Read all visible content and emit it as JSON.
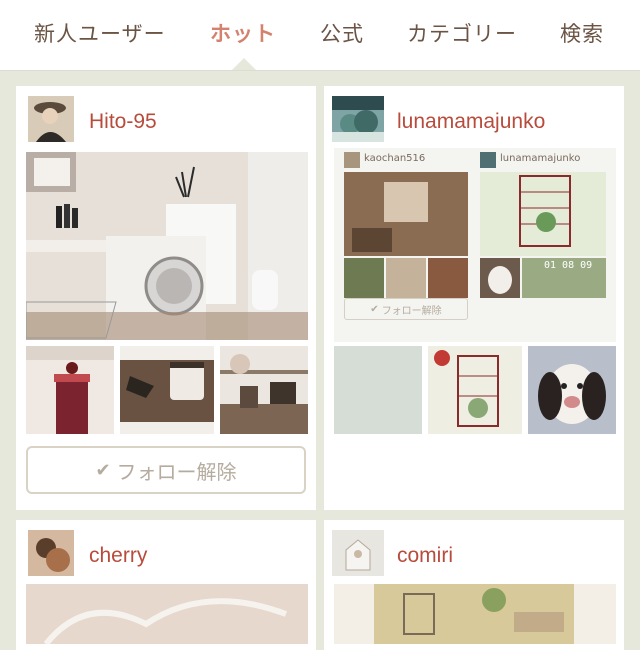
{
  "nav": {
    "items": [
      "新人ユーザー",
      "ホット",
      "公式",
      "カテゴリー",
      "検索"
    ],
    "active_index": 1
  },
  "cards": [
    {
      "username": "Hito-95",
      "follow_label": "フォロー解除"
    },
    {
      "username": "lunamamajunko",
      "embedded": {
        "user_left": "kaochan516",
        "user_right": "lunamamajunko",
        "follow_label": "フォロー解除",
        "date_text": "01 08 09"
      }
    },
    {
      "username": "cherry"
    },
    {
      "username": "comiri"
    }
  ],
  "colors": {
    "accent": "#d4826e",
    "username": "#b84c3c",
    "nav_text": "#6b5444",
    "background": "#e6e8dc"
  },
  "icons": {
    "follow_check": "check-icon"
  }
}
